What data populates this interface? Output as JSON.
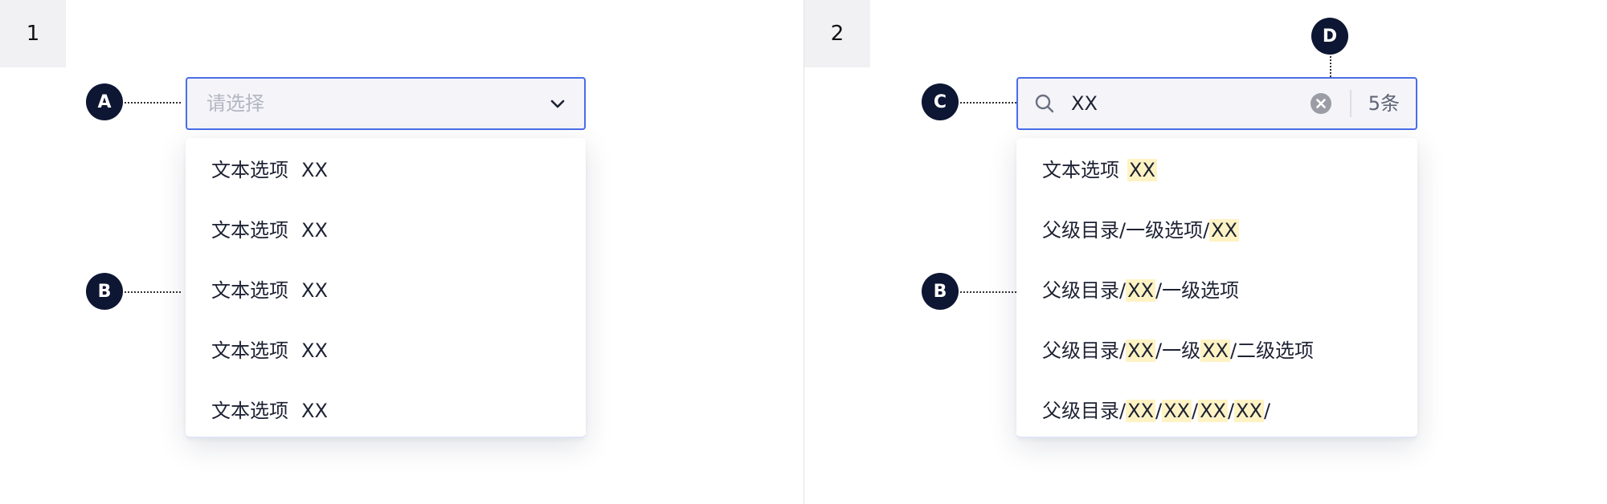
{
  "panel1": {
    "number": "1",
    "callout_a": "A",
    "callout_b": "B",
    "select": {
      "placeholder": "请选择"
    },
    "options": [
      {
        "text": "文本选项",
        "suffix": "XX"
      },
      {
        "text": "文本选项",
        "suffix": "XX"
      },
      {
        "text": "文本选项",
        "suffix": "XX"
      },
      {
        "text": "文本选项",
        "suffix": "XX"
      },
      {
        "text": "文本选项",
        "suffix": "XX"
      }
    ]
  },
  "panel2": {
    "number": "2",
    "callout_c": "C",
    "callout_b": "B",
    "callout_d": "D",
    "search": {
      "value": "XX",
      "count": "5条"
    },
    "results": [
      [
        {
          "t": "文本选项",
          "h": false
        },
        {
          "t": "XX",
          "h": true
        }
      ],
      [
        {
          "t": "父级目录/一级选项/",
          "h": false
        },
        {
          "t": "XX",
          "h": true
        }
      ],
      [
        {
          "t": "父级目录/",
          "h": false
        },
        {
          "t": "XX",
          "h": true
        },
        {
          "t": "/一级选项",
          "h": false
        }
      ],
      [
        {
          "t": "父级目录/",
          "h": false
        },
        {
          "t": "XX",
          "h": true
        },
        {
          "t": "/一级",
          "h": false
        },
        {
          "t": "XX",
          "h": true
        },
        {
          "t": "/二级选项",
          "h": false
        }
      ],
      [
        {
          "t": "父级目录/",
          "h": false
        },
        {
          "t": "XX",
          "h": true
        },
        {
          "t": "/",
          "h": false
        },
        {
          "t": "XX",
          "h": true
        },
        {
          "t": "/",
          "h": false
        },
        {
          "t": "XX",
          "h": true
        },
        {
          "t": "/",
          "h": false
        },
        {
          "t": "XX",
          "h": true
        },
        {
          "t": "/",
          "h": false
        }
      ]
    ]
  },
  "colors": {
    "accent": "#4a6ee8",
    "callout": "#0d1633",
    "highlight": "#fff3c4",
    "input_bg": "#f4f4f9"
  }
}
